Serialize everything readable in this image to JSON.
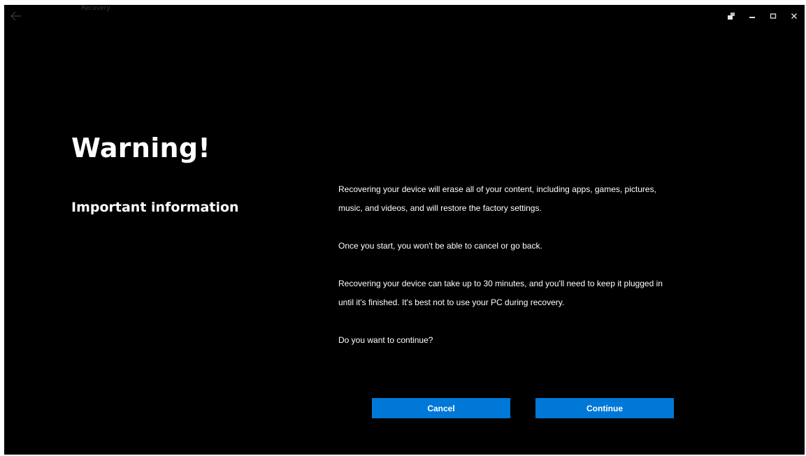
{
  "titlebar": {
    "title": "Recovery"
  },
  "icons": {
    "back": "back-arrow-icon",
    "restore": "restore-icon",
    "minimize": "minimize-icon",
    "maximize": "maximize-icon",
    "close": "close-icon"
  },
  "page": {
    "heading": "Warning!",
    "subheading": "Important information",
    "paragraphs": [
      "Recovering your device will erase all of your content, including apps, games, pictures, music, and videos, and will restore the factory settings.",
      "Once you start, you won't be able to cancel or go back.",
      "Recovering your device can take up to 30 minutes, and you'll need to keep it plugged in until it's finished. It's best not to use your PC during recovery.",
      "Do you want to continue?"
    ]
  },
  "buttons": {
    "cancel": "Cancel",
    "continue": "Continue"
  },
  "colors": {
    "background": "#000000",
    "text": "#ffffff",
    "accent": "#0078d7"
  }
}
